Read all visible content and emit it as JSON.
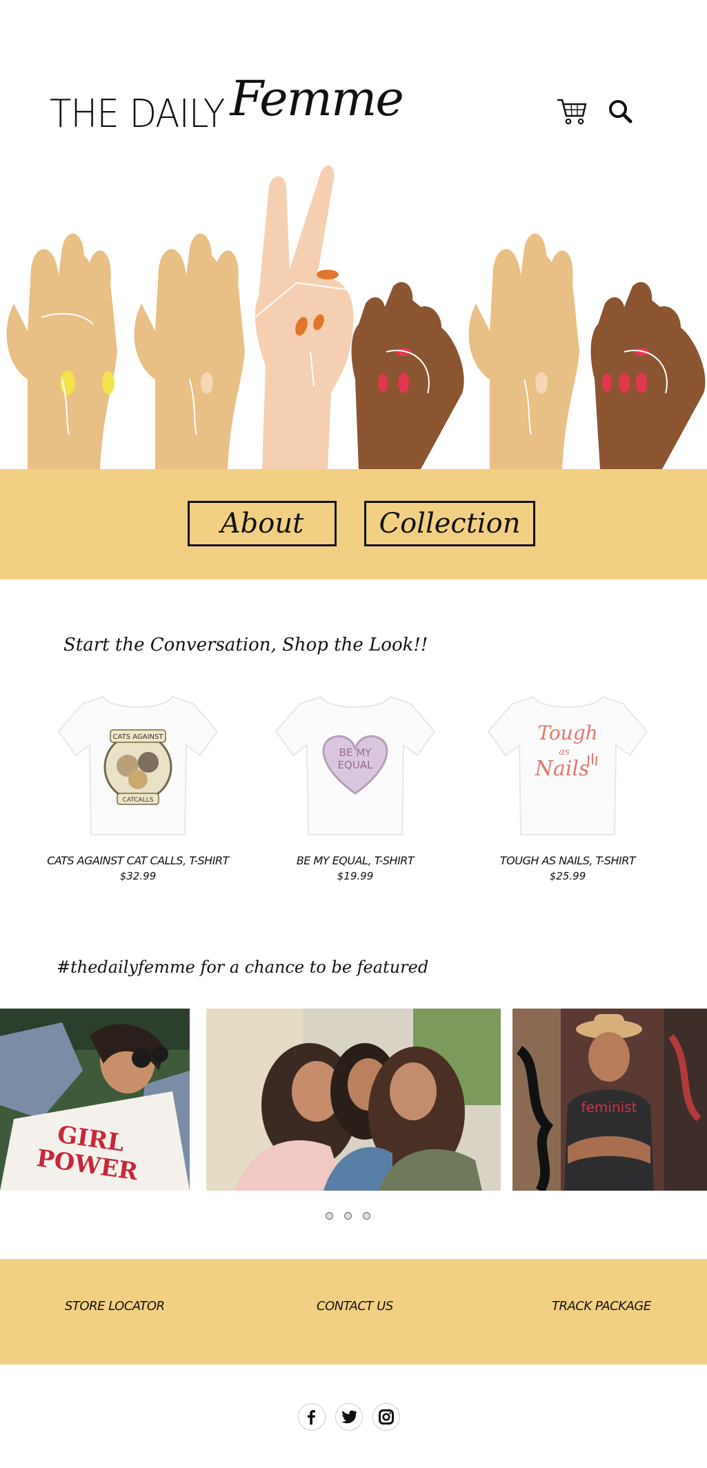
{
  "header": {
    "logo_main": "THE DAILY",
    "logo_script": "Femme",
    "cart_icon": "shopping-cart-icon",
    "search_icon": "search-icon"
  },
  "nav": {
    "about": "About",
    "collection": "Collection"
  },
  "colors": {
    "band": "#f2d083",
    "text": "#111111"
  },
  "shop": {
    "title": "Start the Conversation, Shop the Look!!",
    "products": [
      {
        "name": "CATS AGAINST CAT CALLS, T-SHIRT",
        "price": "$32.99",
        "graphic_text": [
          "CATS AGAINST",
          "CATCALLS"
        ]
      },
      {
        "name": "BE MY EQUAL, T-SHIRT",
        "price": "$19.99",
        "graphic_text": [
          "BE MY",
          "EQUAL"
        ]
      },
      {
        "name": "TOUGH AS NAILS, T-SHIRT",
        "price": "$25.99",
        "graphic_text": [
          "Tough",
          "as",
          "Nails"
        ]
      }
    ]
  },
  "community": {
    "hashtag": "#thedailyfemme for a chance to be featured",
    "photo1_text": [
      "GIRL",
      "POWER"
    ],
    "photo3_text": "feminist"
  },
  "footer": {
    "links": [
      "STORE LOCATOR",
      "CONTACT US",
      "TRACK PACKAGE"
    ],
    "social": [
      "facebook-icon",
      "twitter-icon",
      "instagram-icon"
    ]
  }
}
